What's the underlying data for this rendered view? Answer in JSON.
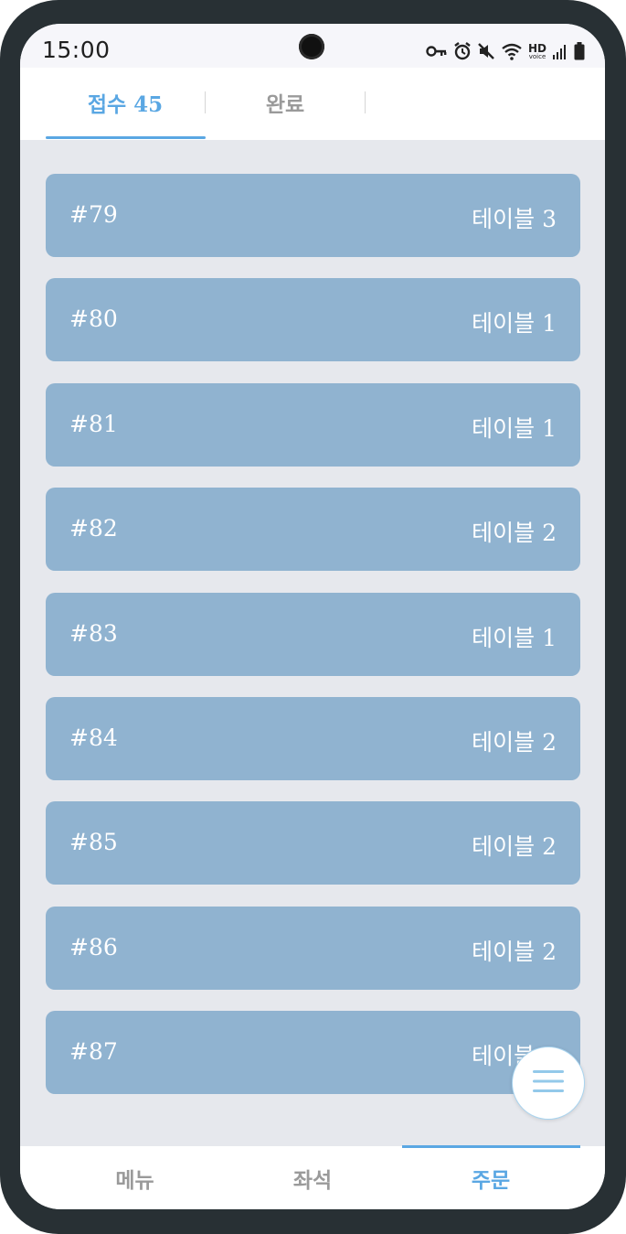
{
  "status_bar": {
    "time": "15:00",
    "icons": [
      "vpn-key-icon",
      "alarm-icon",
      "mute-icon",
      "wifi-icon",
      "hd-voice-icon",
      "signal-icon",
      "battery-icon"
    ],
    "hd_label": "HD",
    "voice_label": "voice"
  },
  "tabs": {
    "received_label": "접수 45",
    "completed_label": "완료",
    "accent_color": "#5aa7e3"
  },
  "orders": [
    {
      "number": "#79",
      "table": "테이블 3"
    },
    {
      "number": "#80",
      "table": "테이블 1"
    },
    {
      "number": "#81",
      "table": "테이블 1"
    },
    {
      "number": "#82",
      "table": "테이블 2"
    },
    {
      "number": "#83",
      "table": "테이블 1"
    },
    {
      "number": "#84",
      "table": "테이블 2"
    },
    {
      "number": "#85",
      "table": "테이블 2"
    },
    {
      "number": "#86",
      "table": "테이블 2"
    },
    {
      "number": "#87",
      "table": "테이블 2"
    }
  ],
  "fab": {
    "icon": "hamburger-menu-icon"
  },
  "bottom_nav": {
    "menu_label": "메뉴",
    "seat_label": "좌석",
    "order_label": "주문",
    "active": "주문"
  },
  "colors": {
    "card": "#90b3d0",
    "background": "#e6e8ed",
    "accent": "#5aa7e3",
    "inactive": "#9a9a9a"
  }
}
